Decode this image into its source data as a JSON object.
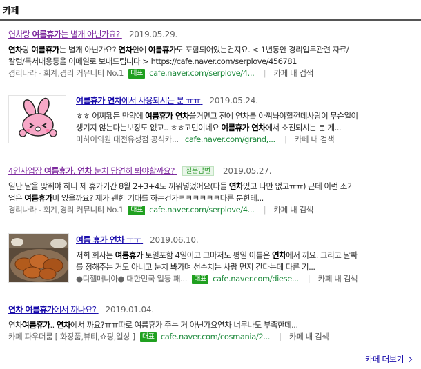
{
  "section": {
    "title": "카페"
  },
  "results": [
    {
      "title_parts": [
        "연차랑 ",
        "여름휴가",
        "는 별개 아닌가요?"
      ],
      "date": "2019.05.29.",
      "desc_line1": [
        {
          "t": "연차",
          "b": true
        },
        {
          "t": "랑 ",
          "b": false
        },
        {
          "t": "여름휴가",
          "b": true
        },
        {
          "t": "는 별개 아닌가요? ",
          "b": false
        },
        {
          "t": "연차",
          "b": true
        },
        {
          "t": "안에 ",
          "b": false
        },
        {
          "t": "여름휴가",
          "b": true
        },
        {
          "t": "도 포함되어있는건지요. < 1년동안 경리업무관련 자료/",
          "b": false
        }
      ],
      "desc_line2": "칼럼/독서내용등을 이메일로 보내드립니다 > https://cafe.naver.com/serplove/456781",
      "cafe_name": "경리나라 - 회계,경리 커뮤니티 No.1",
      "badge": "대표",
      "cafe_url": "cafe.naver.com/serplove/4...",
      "in_cafe": "카페 내 검색"
    },
    {
      "title_parts": [
        "여름휴가 연차",
        "에서 사용되시는 분 ㅠㅠ"
      ],
      "date": "2019.05.24.",
      "desc_line1": [
        {
          "t": "ㅎㅎ 어찌됐든 만약에 ",
          "b": false
        },
        {
          "t": "여름휴가 연차",
          "b": true
        },
        {
          "t": "쓸거면그 전에 연차를 아껴놔야할껀데사람이 무슨일이",
          "b": false
        }
      ],
      "desc_line2_parts": [
        {
          "t": "생기지 않는다는보장도 없고.. ㅎㅎ고민이네요 ",
          "b": false
        },
        {
          "t": "여름휴가 연차",
          "b": true
        },
        {
          "t": "에서 소진되시는 분 계...",
          "b": false
        }
      ],
      "cafe_name": "미하이의원 대전유성점 공식카...",
      "cafe_url": "cafe.naver.com/grand,...",
      "in_cafe": "카페 내 검색"
    },
    {
      "title_parts": [
        "4인사업장 ",
        "여름휴가",
        ", ",
        "연차",
        " 눈치 당연히 봐야할까요?"
      ],
      "qa_badge": "질문답변",
      "date": "2019.05.27.",
      "desc_line1": [
        {
          "t": "일단 날을 맞춰야 하니 제 휴가기간 8월 2+3+4도 끼워넣었어요(다들 ",
          "b": false
        },
        {
          "t": "연차",
          "b": true
        },
        {
          "t": "있고 나만 없고ㅠㅠ) 근데 이런 소기",
          "b": false
        }
      ],
      "desc_line2_parts": [
        {
          "t": "업은 ",
          "b": false
        },
        {
          "t": "여름휴가",
          "b": true
        },
        {
          "t": "비 있을까요? 제가 괜한 기대를 하는건가ㅋㅋㅋㅋㅋㅋ다른 분한테...",
          "b": false
        }
      ],
      "cafe_name": "경리나라 - 회계,경리 커뮤니티 No.1",
      "badge": "대표",
      "cafe_url": "cafe.naver.com/serplove/4...",
      "in_cafe": "카페 내 검색"
    },
    {
      "title_parts": [
        "여름 휴가 연차",
        " ㅜㅜ"
      ],
      "date": "2019.06.10.",
      "desc_line1": [
        {
          "t": "저희 회사는 ",
          "b": false
        },
        {
          "t": "여름휴가",
          "b": true
        },
        {
          "t": " 토일포함 4일이고 그마저도 평일 이틀은 ",
          "b": false
        },
        {
          "t": "연차",
          "b": true
        },
        {
          "t": "에서 까요. 그리고 날짜",
          "b": false
        }
      ],
      "desc_line2": "를 정해주는 거도 아니고 눈치 봐가며 선수치는 사람 먼저 간다는데 다른 기...",
      "cafe_name": "●디젤매니아● 대한민국 일등 패...",
      "badge": "대표",
      "cafe_url": "cafe.naver.com/diese...",
      "in_cafe": "카페 내 검색"
    },
    {
      "title_parts": [
        "연차 여름휴가",
        "에서 까나요?"
      ],
      "date": "2019.01.04.",
      "desc_line1": [
        {
          "t": "연차",
          "b": false
        },
        {
          "t": "여름휴가",
          "b": true
        },
        {
          "t": ".. ",
          "b": false
        },
        {
          "t": "연차",
          "b": true
        },
        {
          "t": "에서 까요?ㅠㅠ따로 여름휴가 주는 거 아닌가요연차 너무나도 부족한데...",
          "b": false
        }
      ],
      "cafe_name": "카페 파우더룸 [ 화장품,뷰티,쇼핑,일상 ]",
      "badge": "대표",
      "cafe_url": "cafe.naver.com/cosmania/2...",
      "in_cafe": "카페 내 검색"
    }
  ],
  "more": {
    "label": "카페 더보기"
  },
  "thumbs": {
    "result2": "bunny-sticker-thumbnail",
    "result4": "fried-chicken-thumbnail"
  }
}
